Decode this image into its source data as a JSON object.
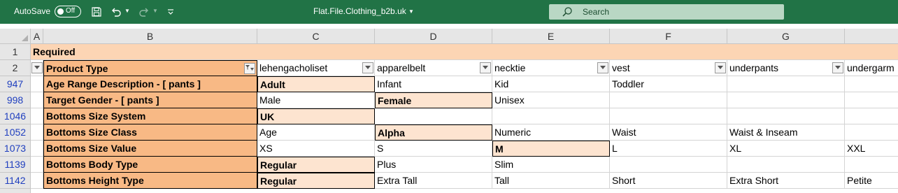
{
  "titlebar": {
    "autosave_label": "AutoSave",
    "autosave_state": "Off",
    "file_name": "Flat.File.Clothing_b2b.uk",
    "search_placeholder": "Search",
    "accent_color": "#217346"
  },
  "sheet": {
    "columns": [
      "A",
      "B",
      "C",
      "D",
      "E",
      "F",
      "G"
    ],
    "row1": {
      "row_number": "1",
      "text": "Required"
    },
    "row2": {
      "row_number": "2",
      "label": "Product Type",
      "values": [
        "lehengacholiset",
        "apparelbelt",
        "necktie",
        "vest",
        "underpants",
        "undergarm"
      ]
    },
    "rows": [
      {
        "row_number": "947",
        "label": "Age Range Description - [ pants ]",
        "values": [
          "Adult",
          "Infant",
          "Kid",
          "Toddler",
          "",
          ""
        ]
      },
      {
        "row_number": "998",
        "label": "Target Gender - [ pants ]",
        "values": [
          "Male",
          "Female",
          "Unisex",
          "",
          "",
          ""
        ]
      },
      {
        "row_number": "1046",
        "label": "Bottoms Size System",
        "values": [
          "UK",
          "",
          "",
          "",
          "",
          ""
        ]
      },
      {
        "row_number": "1052",
        "label": "Bottoms Size Class",
        "values": [
          "Age",
          "Alpha",
          "Numeric",
          "Waist",
          "Waist & Inseam",
          ""
        ]
      },
      {
        "row_number": "1073",
        "label": "Bottoms Size Value",
        "values": [
          "XS",
          "S",
          "M",
          "L",
          "XL",
          "XXL"
        ]
      },
      {
        "row_number": "1139",
        "label": "Bottoms Body Type",
        "values": [
          "Regular",
          "Plus",
          "Slim",
          "",
          "",
          ""
        ]
      },
      {
        "row_number": "1142",
        "label": "Bottoms Height Type",
        "values": [
          "Regular",
          "Extra Tall",
          "Tall",
          "Short",
          "Extra Short",
          "Petite"
        ]
      }
    ]
  }
}
